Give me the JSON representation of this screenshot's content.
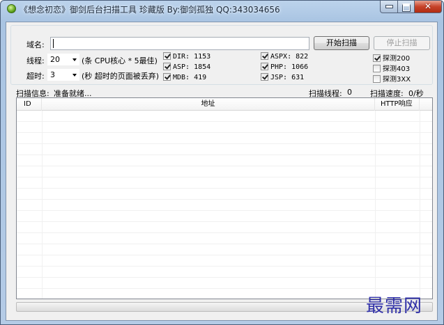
{
  "window": {
    "title": "《想念初恋》御剑后台扫描工具 珍藏版 By:御剑孤独 QQ:343034656",
    "controls": {
      "close_symbol": "✕"
    }
  },
  "form": {
    "domain_label": "域名:",
    "domain_value": "",
    "start_button": "开始扫描",
    "stop_button": "停止扫描",
    "threads_label": "线程:",
    "threads_value": "20",
    "threads_hint": "(条 CPU核心 * 5最佳)",
    "timeout_label": "超时:",
    "timeout_value": "3",
    "timeout_hint": "(秒 超时的页面被丢弃)",
    "dictionaries": [
      {
        "label": "DIR: 1153",
        "checked": true
      },
      {
        "label": "ASP: 1854",
        "checked": true
      },
      {
        "label": "MDB: 419",
        "checked": true
      },
      {
        "label": "ASPX: 822",
        "checked": true
      },
      {
        "label": "PHP: 1066",
        "checked": true
      },
      {
        "label": "JSP: 631",
        "checked": true
      }
    ],
    "detect": [
      {
        "label": "探测200",
        "checked": true
      },
      {
        "label": "探测403",
        "checked": false
      },
      {
        "label": "探测3XX",
        "checked": false
      }
    ]
  },
  "status": {
    "info_label": "扫描信息:",
    "info_value": "准备就绪...",
    "threads_label": "扫描线程:",
    "threads_value": "0",
    "speed_label": "扫描速度:",
    "speed_value": "0/秒"
  },
  "table": {
    "columns": [
      "ID",
      "地址",
      "HTTP响应"
    ],
    "rows": []
  },
  "progress": {
    "value": 0
  },
  "watermark": "最需网",
  "colors": {
    "title_bar": "#bcd3ec",
    "close_button": "#c7432a",
    "watermark": "#2f2fa8"
  }
}
